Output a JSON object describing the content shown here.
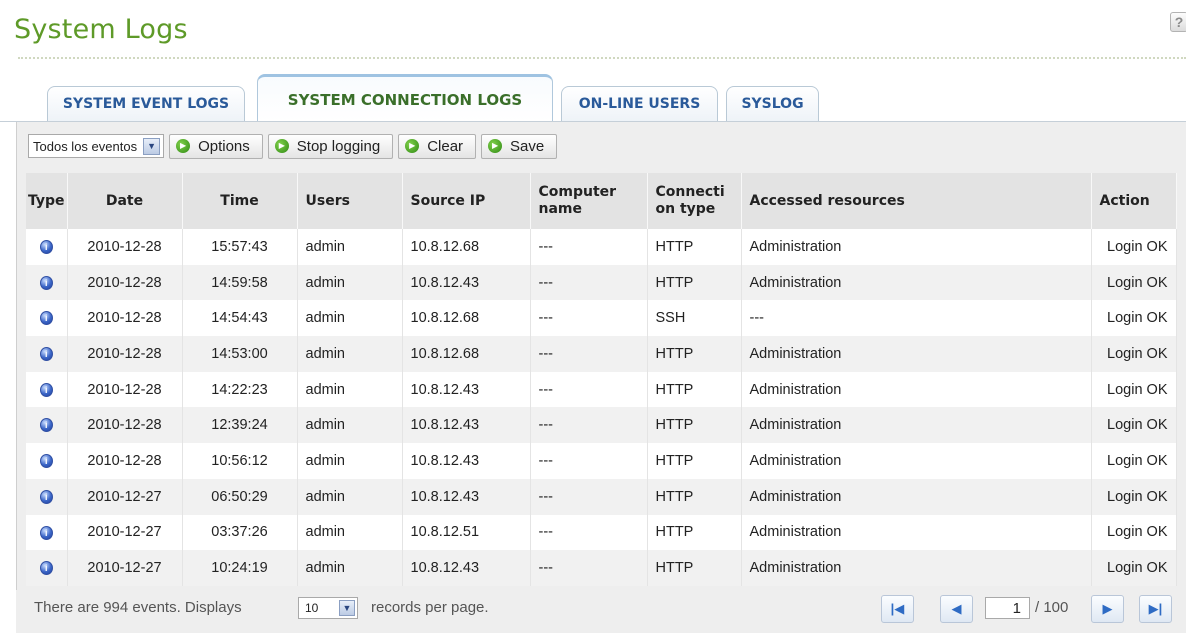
{
  "page": {
    "title": "System Logs",
    "help": "?"
  },
  "tabs": [
    {
      "label": "SYSTEM EVENT LOGS",
      "active": false
    },
    {
      "label": "SYSTEM CONNECTION LOGS",
      "active": true
    },
    {
      "label": "ON-LINE USERS",
      "active": false
    },
    {
      "label": "SYSLOG",
      "active": false
    }
  ],
  "toolbar": {
    "filter_value": "Todos los eventos",
    "options_label": "Options",
    "stop_label": "Stop logging",
    "clear_label": "Clear",
    "save_label": "Save"
  },
  "table": {
    "columns": [
      "Type",
      "Date",
      "Time",
      "Users",
      "Source IP",
      "Computer name",
      "Connection type",
      "Accessed resources",
      "Action"
    ],
    "rows": [
      {
        "type": "info",
        "date": "2010-12-28",
        "time": "15:57:43",
        "user": "admin",
        "ip": "10.8.12.68",
        "computer": "---",
        "conn": "HTTP",
        "resource": "Administration",
        "action": "Login OK"
      },
      {
        "type": "info",
        "date": "2010-12-28",
        "time": "14:59:58",
        "user": "admin",
        "ip": "10.8.12.43",
        "computer": "---",
        "conn": "HTTP",
        "resource": "Administration",
        "action": "Login OK"
      },
      {
        "type": "info",
        "date": "2010-12-28",
        "time": "14:54:43",
        "user": "admin",
        "ip": "10.8.12.68",
        "computer": "---",
        "conn": "SSH",
        "resource": "---",
        "action": "Login OK"
      },
      {
        "type": "info",
        "date": "2010-12-28",
        "time": "14:53:00",
        "user": "admin",
        "ip": "10.8.12.68",
        "computer": "---",
        "conn": "HTTP",
        "resource": "Administration",
        "action": "Login OK"
      },
      {
        "type": "info",
        "date": "2010-12-28",
        "time": "14:22:23",
        "user": "admin",
        "ip": "10.8.12.43",
        "computer": "---",
        "conn": "HTTP",
        "resource": "Administration",
        "action": "Login OK"
      },
      {
        "type": "info",
        "date": "2010-12-28",
        "time": "12:39:24",
        "user": "admin",
        "ip": "10.8.12.43",
        "computer": "---",
        "conn": "HTTP",
        "resource": "Administration",
        "action": "Login OK"
      },
      {
        "type": "info",
        "date": "2010-12-28",
        "time": "10:56:12",
        "user": "admin",
        "ip": "10.8.12.43",
        "computer": "---",
        "conn": "HTTP",
        "resource": "Administration",
        "action": "Login OK"
      },
      {
        "type": "info",
        "date": "2010-12-27",
        "time": "06:50:29",
        "user": "admin",
        "ip": "10.8.12.43",
        "computer": "---",
        "conn": "HTTP",
        "resource": "Administration",
        "action": "Login OK"
      },
      {
        "type": "info",
        "date": "2010-12-27",
        "time": "03:37:26",
        "user": "admin",
        "ip": "10.8.12.51",
        "computer": "---",
        "conn": "HTTP",
        "resource": "Administration",
        "action": "Login OK"
      },
      {
        "type": "info",
        "date": "2010-12-27",
        "time": "10:24:19",
        "user": "admin",
        "ip": "10.8.12.43",
        "computer": "---",
        "conn": "HTTP",
        "resource": "Administration",
        "action": "Login OK"
      }
    ]
  },
  "footer": {
    "summary": "There are 994 events. Displays",
    "per_page": "10",
    "per_page_suffix": "records per page.",
    "current_page": "1",
    "total_pages": "/ 100"
  },
  "colors": {
    "title": "#5e9a28",
    "tab_text": "#2a5a9a",
    "active_tab_text": "#3a6f2a",
    "go_icon": "#2f8a14",
    "info_icon": "#3b66c8"
  }
}
